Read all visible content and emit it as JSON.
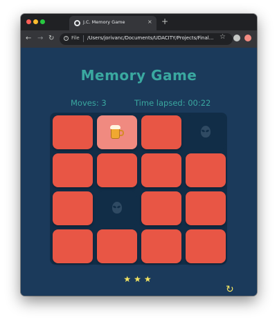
{
  "browser": {
    "tab_title": "J.C. Memory Game",
    "tab_close": "×",
    "new_tab": "+",
    "address_file_label": "File",
    "address_url": "/Users/jorivanc/Documents/UDACITY/Projects/Final...",
    "back_glyph": "←",
    "forward_glyph": "→",
    "reload_glyph": "↻",
    "star_glyph": "☆"
  },
  "game": {
    "title": "Memory Game",
    "moves_text": "Moves: 3",
    "time_text": "Time lapsed: 00:22",
    "stars": "★★★",
    "restart_glyph": "↻"
  },
  "deck": {
    "rows": 4,
    "cols": 4,
    "cards": [
      {
        "state": "closed"
      },
      {
        "state": "open",
        "icon": "beer-mug-icon"
      },
      {
        "state": "closed"
      },
      {
        "state": "matched",
        "icon": "alien-icon"
      },
      {
        "state": "closed"
      },
      {
        "state": "closed"
      },
      {
        "state": "closed"
      },
      {
        "state": "closed"
      },
      {
        "state": "closed"
      },
      {
        "state": "matched",
        "icon": "alien-icon"
      },
      {
        "state": "closed"
      },
      {
        "state": "closed"
      },
      {
        "state": "closed"
      },
      {
        "state": "closed"
      },
      {
        "state": "closed"
      },
      {
        "state": "closed"
      }
    ]
  },
  "colors": {
    "page_background": "#1b3a5b",
    "deck_background": "#112d47",
    "card_closed": "#e85645",
    "card_open": "#f08a80",
    "title_teal": "#3aa8a0",
    "stars_yellow": "#f5e663"
  }
}
